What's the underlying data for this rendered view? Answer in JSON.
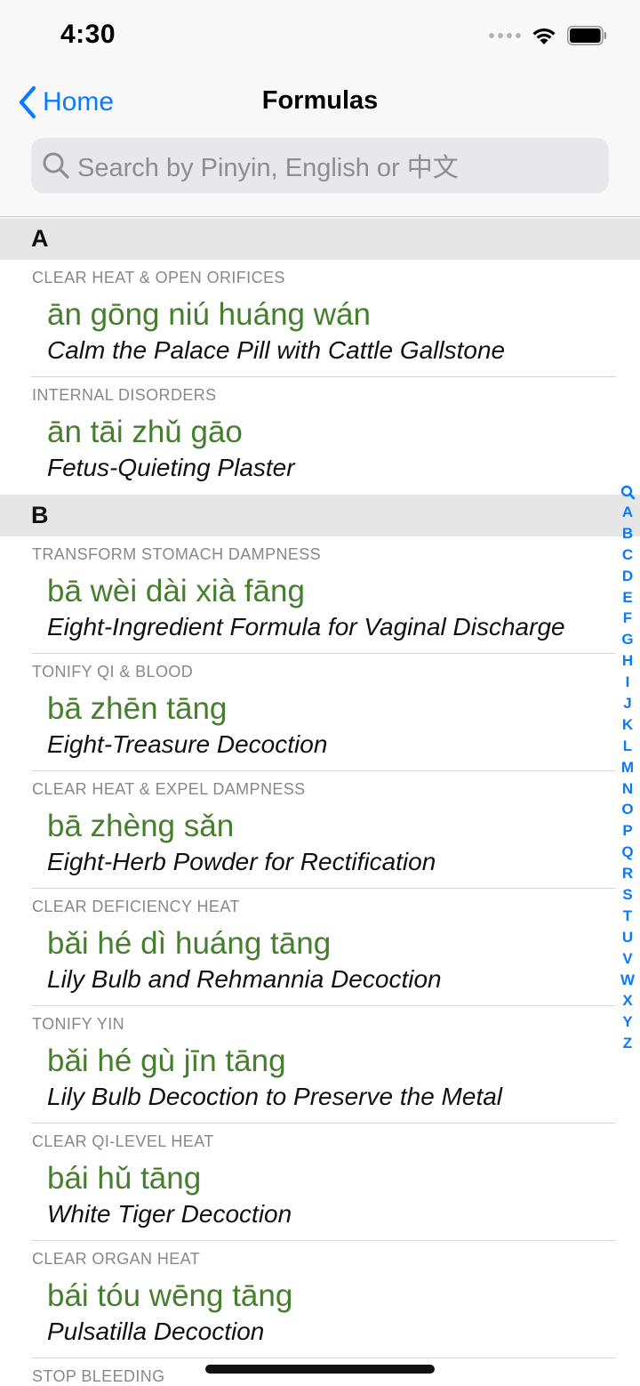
{
  "status": {
    "time": "4:30"
  },
  "nav": {
    "back_label": "Home",
    "title": "Formulas"
  },
  "search": {
    "placeholder": "Search by Pinyin, English or 中文"
  },
  "sections": [
    {
      "letter": "A",
      "items": [
        {
          "category": "CLEAR HEAT & OPEN ORIFICES",
          "pinyin": "ān gōng niú huáng wán",
          "english": "Calm the Palace Pill with Cattle Gallstone"
        },
        {
          "category": "INTERNAL DISORDERS",
          "pinyin": "ān tāi zhǔ gāo",
          "english": "Fetus-Quieting Plaster"
        }
      ]
    },
    {
      "letter": "B",
      "items": [
        {
          "category": "TRANSFORM STOMACH DAMPNESS",
          "pinyin": "bā wèi dài xià fāng",
          "english": "Eight-Ingredient Formula for Vaginal Discharge"
        },
        {
          "category": "TONIFY QI & BLOOD",
          "pinyin": "bā zhēn tāng",
          "english": "Eight-Treasure Decoction"
        },
        {
          "category": "CLEAR HEAT & EXPEL DAMPNESS",
          "pinyin": "bā zhèng sǎn",
          "english": "Eight-Herb Powder for Rectification"
        },
        {
          "category": "CLEAR DEFICIENCY HEAT",
          "pinyin": "bǎi hé dì huáng tāng",
          "english": "Lily Bulb and Rehmannia Decoction"
        },
        {
          "category": "TONIFY YIN",
          "pinyin": "bǎi hé gù jīn tāng",
          "english": "Lily Bulb Decoction to Preserve the Metal"
        },
        {
          "category": "CLEAR QI-LEVEL HEAT",
          "pinyin": "bái hǔ tāng",
          "english": "White Tiger Decoction"
        },
        {
          "category": "CLEAR ORGAN HEAT",
          "pinyin": "bái tóu wēng tāng",
          "english": "Pulsatilla Decoction"
        },
        {
          "category": "STOP BLEEDING",
          "pinyin": "",
          "english": ""
        }
      ]
    }
  ],
  "index": [
    "A",
    "B",
    "C",
    "D",
    "E",
    "F",
    "G",
    "H",
    "I",
    "J",
    "K",
    "L",
    "M",
    "N",
    "O",
    "P",
    "Q",
    "R",
    "S",
    "T",
    "U",
    "V",
    "W",
    "X",
    "Y",
    "Z"
  ],
  "colors": {
    "accent": "#0a7aff",
    "pinyin": "#457f2d",
    "section_bg": "#e6e6e6"
  }
}
